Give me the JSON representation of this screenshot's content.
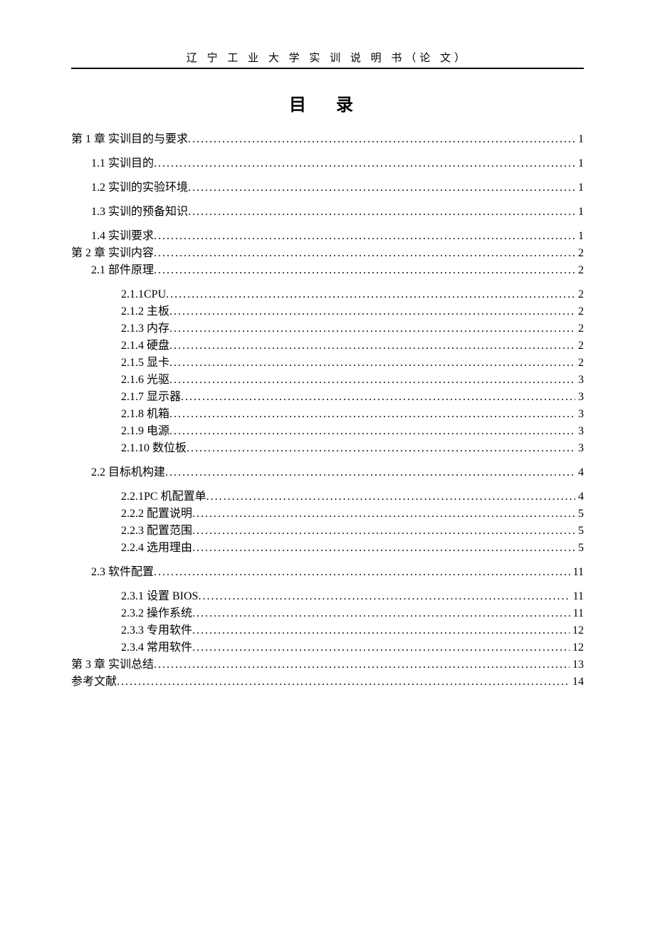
{
  "header": "辽 宁 工 业 大 学 实 训 说 明 书（论 文）",
  "title": "目  录",
  "toc": [
    {
      "level": 0,
      "label": "第 1 章    实训目的与要求",
      "page": "1",
      "spaced": false
    },
    {
      "level": 1,
      "label": "1.1 实训目的",
      "page": "1",
      "spaced": true
    },
    {
      "level": 1,
      "label": "1.2 实训的实验环境",
      "page": "1",
      "spaced": true
    },
    {
      "level": 1,
      "label": "1.3 实训的预备知识",
      "page": "1",
      "spaced": true
    },
    {
      "level": 1,
      "label": "1.4 实训要求",
      "page": "1",
      "spaced": true
    },
    {
      "level": 0,
      "label": "第 2 章    实训内容",
      "page": "2",
      "spaced": false
    },
    {
      "level": 1,
      "label": "2.1 部件原理",
      "page": "2",
      "spaced": false
    },
    {
      "level": 2,
      "label": "2.1.1CPU",
      "page": "2",
      "spaced": true
    },
    {
      "level": 2,
      "label": "2.1.2 主板",
      "page": "2",
      "spaced": false
    },
    {
      "level": 2,
      "label": "2.1.3 内存",
      "page": "2",
      "spaced": false
    },
    {
      "level": 2,
      "label": "2.1.4 硬盘",
      "page": "2",
      "spaced": false
    },
    {
      "level": 2,
      "label": "2.1.5 显卡",
      "page": "2",
      "spaced": false
    },
    {
      "level": 2,
      "label": "2.1.6 光驱",
      "page": "3",
      "spaced": false
    },
    {
      "level": 2,
      "label": "2.1.7 显示器",
      "page": "3",
      "spaced": false
    },
    {
      "level": 2,
      "label": "2.1.8 机箱",
      "page": "3",
      "spaced": false
    },
    {
      "level": 2,
      "label": "2.1.9 电源",
      "page": "3",
      "spaced": false
    },
    {
      "level": 2,
      "label": "2.1.10 数位板",
      "page": "3",
      "spaced": false
    },
    {
      "level": 1,
      "label": "2.2 目标机构建",
      "page": "4",
      "spaced": true
    },
    {
      "level": 2,
      "label": "2.2.1PC 机配置单",
      "page": "4",
      "spaced": true
    },
    {
      "level": 2,
      "label": "2.2.2 配置说明",
      "page": "5",
      "spaced": false
    },
    {
      "level": 2,
      "label": "2.2.3 配置范围",
      "page": "5",
      "spaced": false
    },
    {
      "level": 2,
      "label": "2.2.4 选用理由",
      "page": "5",
      "spaced": false
    },
    {
      "level": 1,
      "label": "2.3 软件配置",
      "page": "11",
      "spaced": true
    },
    {
      "level": 2,
      "label": "2.3.1 设置 BIOS",
      "page": "11",
      "spaced": true
    },
    {
      "level": 2,
      "label": "2.3.2 操作系统",
      "page": "11",
      "spaced": false
    },
    {
      "level": 2,
      "label": "2.3.3 专用软件",
      "page": "12",
      "spaced": false
    },
    {
      "level": 2,
      "label": "2.3.4 常用软件",
      "page": "12",
      "spaced": false
    },
    {
      "level": 0,
      "label": "第 3 章    实训总结",
      "page": "13",
      "spaced": false
    },
    {
      "level": 0,
      "label": "参考文献",
      "page": "14",
      "spaced": false
    }
  ]
}
